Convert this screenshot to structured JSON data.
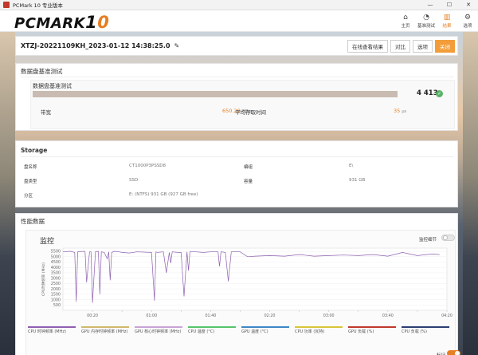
{
  "window": {
    "title": "PCMark 10 专业版本",
    "controls": [
      "—",
      "☐",
      "✕"
    ]
  },
  "brand": {
    "name": "PCMARK",
    "version_1": "1",
    "version_0": "0"
  },
  "nav": [
    {
      "label": "主页",
      "icon": "home-icon",
      "glyph": "⌂"
    },
    {
      "label": "基准测试",
      "icon": "gauge-icon",
      "glyph": "◔"
    },
    {
      "label": "结果",
      "icon": "bars-icon",
      "glyph": "▥"
    },
    {
      "label": "选项",
      "icon": "gear-icon",
      "glyph": "⚙"
    }
  ],
  "result": {
    "name": "XTZJ-20221109KH_2023-01-12 14:38:25.0",
    "buttons": {
      "online": "在线查看结果",
      "compare": "对比",
      "options": "选项",
      "close": "关闭"
    }
  },
  "benchmark": {
    "section_title": "数据盘基准测试",
    "card_title": "数据盘基准测试",
    "score": "4 413",
    "bandwidth_label": "带宽",
    "bandwidth_value": "650.29",
    "bandwidth_unit": "MB/s",
    "access_label": "平均存取时间",
    "access_value": "35",
    "access_unit": "μs"
  },
  "storage": {
    "title": "Storage",
    "rows": [
      {
        "label": "盘名称",
        "value": "CT1000P3PSSD8",
        "label2": "编组",
        "value2": "E\\"
      },
      {
        "label": "盘类型",
        "value": "SSD",
        "label2": "容量",
        "value2": "931 GB"
      },
      {
        "label": "分区",
        "value": "E: (NTFS) 931 GB (927 GB free)"
      }
    ]
  },
  "performance": {
    "section_title": "性能数据",
    "monitor_title": "监控",
    "toggle_label": "监控细节",
    "toggle_on": false,
    "mark_label": "标记",
    "mark_on": true,
    "yaxis_label": "CPU时钟频率 (MHz)",
    "yticks": [
      "5500",
      "5000",
      "4500",
      "4000",
      "3500",
      "3000",
      "2500",
      "2000",
      "1500",
      "1000",
      "500"
    ],
    "xticks": [
      "00:20",
      "00:40",
      "01:00",
      "01:20",
      "01:40",
      "02:00",
      "02:20",
      "02:40",
      "03:00",
      "03:20",
      "03:40",
      "04:00",
      "04:20"
    ],
    "legend": [
      {
        "label": "CPU 时钟频率 (MHz)",
        "color": "#8e5fb0"
      },
      {
        "label": "GPU 内存时钟频率 (MHz)",
        "color": "#d2b86e"
      },
      {
        "label": "GPU 核心时钟频率 (MHz)",
        "color": "#c9a3d6"
      },
      {
        "label": "CPU 温度 (°C)",
        "color": "#55c46a"
      },
      {
        "label": "GPU 温度 (°C)",
        "color": "#3d86c6"
      },
      {
        "label": "CPU 功率 (瓦特)",
        "color": "#d8c53a"
      },
      {
        "label": "GPU 负载 (%)",
        "color": "#c0392b"
      },
      {
        "label": "CPU 负载 (%)",
        "color": "#2c3e73"
      }
    ]
  },
  "chart_data": {
    "type": "line",
    "title": "",
    "xlabel": "",
    "ylabel": "CPU时钟频率 (MHz)",
    "ylim": [
      0,
      5800
    ],
    "xlim_seconds": [
      0,
      260
    ],
    "series": [
      {
        "name": "CPU 时钟频率 (MHz)",
        "x": [
          0,
          5,
          8,
          9,
          10,
          14,
          15,
          16,
          18,
          19,
          20,
          22,
          24,
          25,
          26,
          28,
          30,
          31,
          32,
          33,
          35,
          38,
          40,
          45,
          50,
          60,
          62,
          63,
          64,
          68,
          70,
          72,
          73,
          74,
          78,
          80,
          82,
          84,
          85,
          86,
          90,
          95,
          100,
          105,
          106,
          107,
          110,
          112,
          114,
          115,
          118,
          120,
          125,
          130,
          140,
          150,
          160,
          170,
          180,
          190,
          200,
          210,
          220,
          230,
          240,
          250,
          255
        ],
        "values": [
          5450,
          5500,
          5400,
          800,
          5450,
          5500,
          5450,
          2600,
          5450,
          5450,
          700,
          5450,
          5500,
          1500,
          5450,
          5400,
          4800,
          5450,
          2800,
          5400,
          5500,
          5450,
          5400,
          5350,
          5450,
          5400,
          900,
          5450,
          5400,
          5450,
          3500,
          5400,
          4400,
          5450,
          5400,
          5400,
          1300,
          5450,
          3700,
          5450,
          5450,
          5400,
          5450,
          5450,
          4100,
          5450,
          5400,
          2700,
          5450,
          5450,
          5450,
          5450,
          5000,
          5050,
          5100,
          5050,
          5200,
          5050,
          5100,
          5150,
          5100,
          5200,
          5050,
          5400,
          5100,
          5250,
          5200
        ]
      }
    ]
  }
}
